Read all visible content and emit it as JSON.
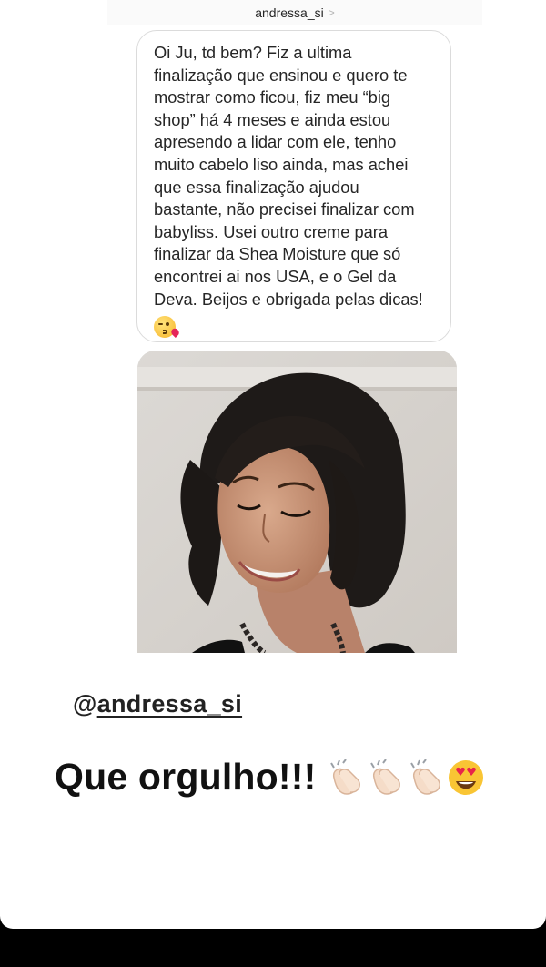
{
  "dm": {
    "username": "andressa_si",
    "header_chevron": ">",
    "message": "Oi Ju, td bem? Fiz a ultima\nfinalização que ensinou e quero te\nmostrar como ficou, fiz meu “big\nshop” há 4 meses e ainda estou\napresendo a lidar com ele, tenho\nmuito cabelo liso ainda, mas achei\nque essa finalização ajudou\nbastante, não precisei finalizar com\nbabyliss. Usei outro creme para\nfinalizar da Shea Moisture que só\nencontrei ai nos USA, e o Gel da\nDeva. Beijos e obrigada pelas dicas!",
    "message_emoji": "face-blowing-kiss-icon"
  },
  "story": {
    "mention_at": "@",
    "mention_name": "andressa_si",
    "caption": "Que orgulho!!!",
    "caption_emojis": [
      "clapping-hands-icon",
      "clapping-hands-icon",
      "clapping-hands-icon",
      "heart-eyes-icon"
    ]
  },
  "colors": {
    "bubble_border": "#dbdbdb",
    "text": "#262626",
    "background": "#ffffff",
    "bottom_bar": "#000000"
  }
}
